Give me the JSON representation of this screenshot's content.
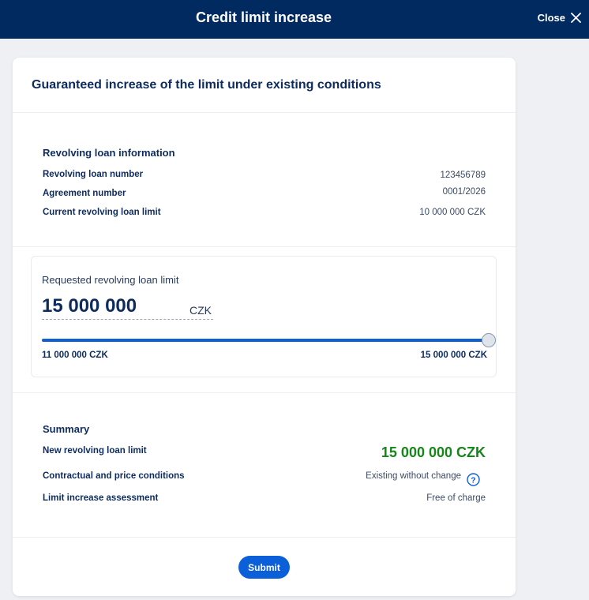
{
  "header": {
    "title": "Credit limit increase",
    "close_label": "Close"
  },
  "card": {
    "title": "Guaranteed increase of the limit under existing conditions"
  },
  "loan_info": {
    "heading": "Revolving loan information",
    "rows": [
      {
        "label": "Revolving loan number",
        "value": "123456789"
      },
      {
        "label": "Agreement number",
        "value": "0001/2026"
      },
      {
        "label": "Current revolving loan limit",
        "value": "10 000 000 CZK"
      }
    ]
  },
  "requested": {
    "label": "Requested revolving loan limit",
    "amount": "15 000 000",
    "currency": "CZK",
    "slider_min_label": "11 000 000 CZK",
    "slider_max_label": "15 000 000 CZK",
    "slider_min": 11000000,
    "slider_max": 15000000,
    "slider_value": 15000000
  },
  "summary": {
    "heading": "Summary",
    "new_limit_label": "New revolving loan limit",
    "new_limit_value": "15 000 000 CZK",
    "conditions_label": "Contractual and price conditions",
    "conditions_value": "Existing without change",
    "assessment_label": "Limit increase assessment",
    "assessment_value": "Free of charge"
  },
  "footer": {
    "submit_label": "Submit"
  },
  "colors": {
    "header_bg": "#012a60",
    "accent": "#0b5fd8",
    "success": "#16861a"
  },
  "icons": {
    "close": "close-icon",
    "help": "help-icon"
  }
}
